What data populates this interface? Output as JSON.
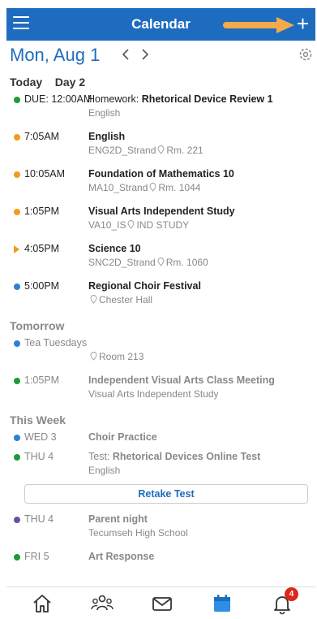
{
  "header": {
    "title": "Calendar",
    "add_label": "+"
  },
  "datebar": {
    "date": "Mon, Aug 1"
  },
  "sections": {
    "today": {
      "label": "Today",
      "day": "Day 2"
    },
    "tomorrow": {
      "label": "Tomorrow"
    },
    "this_week": {
      "label": "This Week"
    }
  },
  "today_items": [
    {
      "time": "DUE: 12:00AM",
      "prefix": "Homework: ",
      "title": "Rhetorical Device Review 1",
      "sub": "English"
    },
    {
      "time": "7:05AM",
      "title": "English",
      "sub": "ENG2D_Strand",
      "room": "Rm. 221"
    },
    {
      "time": "10:05AM",
      "title": "Foundation of Mathematics 10",
      "sub": "MA10_Strand",
      "room": "Rm. 1044"
    },
    {
      "time": "1:05PM",
      "title": "Visual Arts Independent Study",
      "sub": "VA10_IS",
      "room": "IND STUDY"
    },
    {
      "time": "4:05PM",
      "title": "Science 10",
      "sub": "SNC2D_Strand",
      "room": "Rm. 1060"
    },
    {
      "time": "5:00PM",
      "title": "Regional Choir Festival",
      "room": "Chester Hall"
    }
  ],
  "tomorrow_items": [
    {
      "time": "Tea Tuesdays",
      "room": "Room 213"
    },
    {
      "time": "1:05PM",
      "title": "Independent Visual Arts Class Meeting",
      "sub": "Visual Arts Independent Study"
    }
  ],
  "week_items": [
    {
      "time": "WED 3",
      "title": "Choir Practice"
    },
    {
      "time": "THU 4",
      "prefix": "Test: ",
      "title": "Rhetorical Devices Online Test",
      "sub": "English",
      "button": "Retake Test"
    },
    {
      "time": "THU 4",
      "title": "Parent night",
      "sub": "Tecumseh High School"
    },
    {
      "time": "FRI 5",
      "title": "Art Response"
    }
  ],
  "colors": {
    "brand": "#1e6cbf",
    "green": "#1e9a3b",
    "orange": "#f39a20",
    "blue": "#2f7fd8",
    "purple": "#6a4fa3",
    "badge": "#d9281c"
  },
  "bottom_nav": {
    "items": [
      "home-icon",
      "people-icon",
      "mail-icon",
      "calendar-icon",
      "bell-icon"
    ],
    "notification_count": "4"
  }
}
